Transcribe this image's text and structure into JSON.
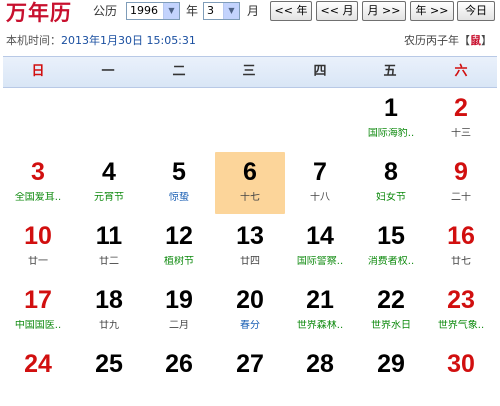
{
  "toolbar": {
    "logo": "万年历",
    "calendar_type": "公历",
    "year_value": "1996",
    "year_suffix": "年",
    "month_value": "3",
    "month_suffix": "月",
    "prev_year": "<< 年",
    "prev_month": "<< 月",
    "next_month": "月 >>",
    "next_year": "年 >>",
    "today": "今日"
  },
  "info": {
    "time_label": "本机时间：",
    "time_value": "2013年1月30日 15:05:31",
    "lunar_year": "农历丙子年【",
    "zodiac": "鼠",
    "lunar_year_close": "】"
  },
  "weekdays": [
    "日",
    "一",
    "二",
    "三",
    "四",
    "五",
    "六"
  ],
  "days": [
    {
      "d": "1",
      "lunar": "国际海豹..",
      "style": "fest",
      "red": false
    },
    {
      "d": "2",
      "lunar": "十三",
      "style": "",
      "red": true
    },
    {
      "d": "3",
      "lunar": "全国爱耳..",
      "style": "fest",
      "red": true
    },
    {
      "d": "4",
      "lunar": "元宵节",
      "style": "fest",
      "red": false
    },
    {
      "d": "5",
      "lunar": "惊蛰",
      "style": "term",
      "red": false
    },
    {
      "d": "6",
      "lunar": "十七",
      "style": "",
      "red": false,
      "today": true
    },
    {
      "d": "7",
      "lunar": "十八",
      "style": "",
      "red": false
    },
    {
      "d": "8",
      "lunar": "妇女节",
      "style": "fest",
      "red": false
    },
    {
      "d": "9",
      "lunar": "二十",
      "style": "",
      "red": true
    },
    {
      "d": "10",
      "lunar": "廿一",
      "style": "",
      "red": true
    },
    {
      "d": "11",
      "lunar": "廿二",
      "style": "",
      "red": false
    },
    {
      "d": "12",
      "lunar": "植树节",
      "style": "fest",
      "red": false
    },
    {
      "d": "13",
      "lunar": "廿四",
      "style": "",
      "red": false
    },
    {
      "d": "14",
      "lunar": "国际警察..",
      "style": "fest",
      "red": false
    },
    {
      "d": "15",
      "lunar": "消费者权..",
      "style": "fest",
      "red": false
    },
    {
      "d": "16",
      "lunar": "廿七",
      "style": "",
      "red": true
    },
    {
      "d": "17",
      "lunar": "中国国医..",
      "style": "fest",
      "red": true
    },
    {
      "d": "18",
      "lunar": "廿九",
      "style": "",
      "red": false
    },
    {
      "d": "19",
      "lunar": "二月",
      "style": "",
      "red": false
    },
    {
      "d": "20",
      "lunar": "春分",
      "style": "term",
      "red": false
    },
    {
      "d": "21",
      "lunar": "世界森林..",
      "style": "fest",
      "red": false
    },
    {
      "d": "22",
      "lunar": "世界水日",
      "style": "fest",
      "red": false
    },
    {
      "d": "23",
      "lunar": "世界气象..",
      "style": "fest",
      "red": true
    },
    {
      "d": "24",
      "lunar": "",
      "style": "",
      "red": true
    },
    {
      "d": "25",
      "lunar": "",
      "style": "",
      "red": false
    },
    {
      "d": "26",
      "lunar": "",
      "style": "",
      "red": false
    },
    {
      "d": "27",
      "lunar": "",
      "style": "",
      "red": false
    },
    {
      "d": "28",
      "lunar": "",
      "style": "",
      "red": false
    },
    {
      "d": "29",
      "lunar": "",
      "style": "",
      "red": false
    },
    {
      "d": "30",
      "lunar": "",
      "style": "",
      "red": true
    }
  ],
  "colors": {
    "weekend_red": "#d10f0f",
    "festival_green": "#0e8a0e",
    "solar_term_blue": "#1a5fb4",
    "today_highlight": "#fcd59a"
  }
}
